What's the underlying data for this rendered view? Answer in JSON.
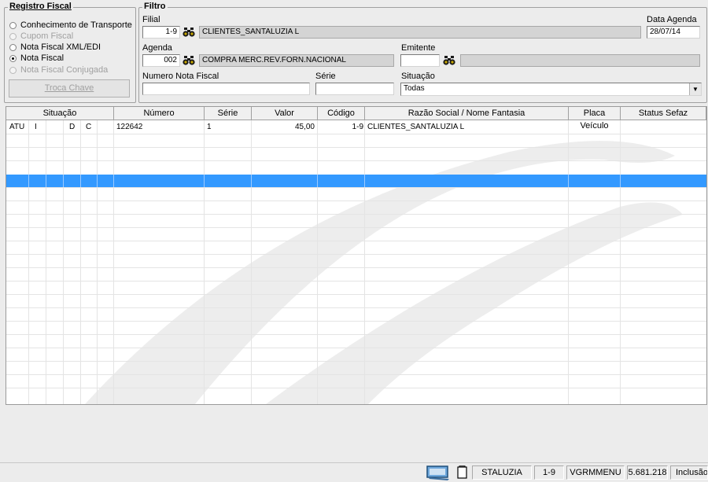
{
  "registro": {
    "title": "Registro Fiscal",
    "options": [
      {
        "label": "Conhecimento de Transporte",
        "checked": false,
        "enabled": true
      },
      {
        "label": "Cupom Fiscal",
        "checked": false,
        "enabled": false
      },
      {
        "label": "Nota Fiscal XML/EDI",
        "checked": false,
        "enabled": true
      },
      {
        "label": "Nota Fiscal",
        "checked": true,
        "enabled": true
      },
      {
        "label": "Nota Fiscal Conjugada",
        "checked": false,
        "enabled": false
      }
    ],
    "troca_label": "Troca Chave"
  },
  "filtro": {
    "title": "Filtro",
    "filial_label": "Filial",
    "filial_code": "1-9",
    "filial_name": "CLIENTES_SANTALUZIA L",
    "data_agenda_label": "Data Agenda",
    "data_agenda_value": "28/07/14",
    "agenda_label": "Agenda",
    "agenda_code": "002",
    "agenda_desc": "COMPRA MERC.REV.FORN.NACIONAL",
    "emitente_label": "Emitente",
    "emitente_code": "",
    "emitente_name": "",
    "nf_label": "Numero Nota Fiscal",
    "nf_value": "",
    "serie_label": "Série",
    "serie_value": "",
    "situacao_label": "Situação",
    "situacao_value": "Todas"
  },
  "grid": {
    "columns": [
      "Situação",
      "Número",
      "Série",
      "Valor",
      "Código",
      "Razão Social / Nome Fantasia",
      "Placa Veículo",
      "Status Sefaz"
    ],
    "rows": [
      {
        "s1": "ATU",
        "s2": "I",
        "s3": "",
        "s4": "D",
        "s5": "C",
        "numero": "122642",
        "serie": "1",
        "valor": "45,00",
        "codigo": "1-9",
        "razao": "CLIENTES_SANTALUZIA L",
        "placa": "",
        "status": ""
      }
    ]
  },
  "status": {
    "user": "STALUZIA",
    "filial": "1-9",
    "module": "VGRMMENU",
    "version": "5.681.218",
    "mode": "Inclusão"
  },
  "colors": {
    "selection": "#3399ff",
    "background": "#ececec"
  }
}
